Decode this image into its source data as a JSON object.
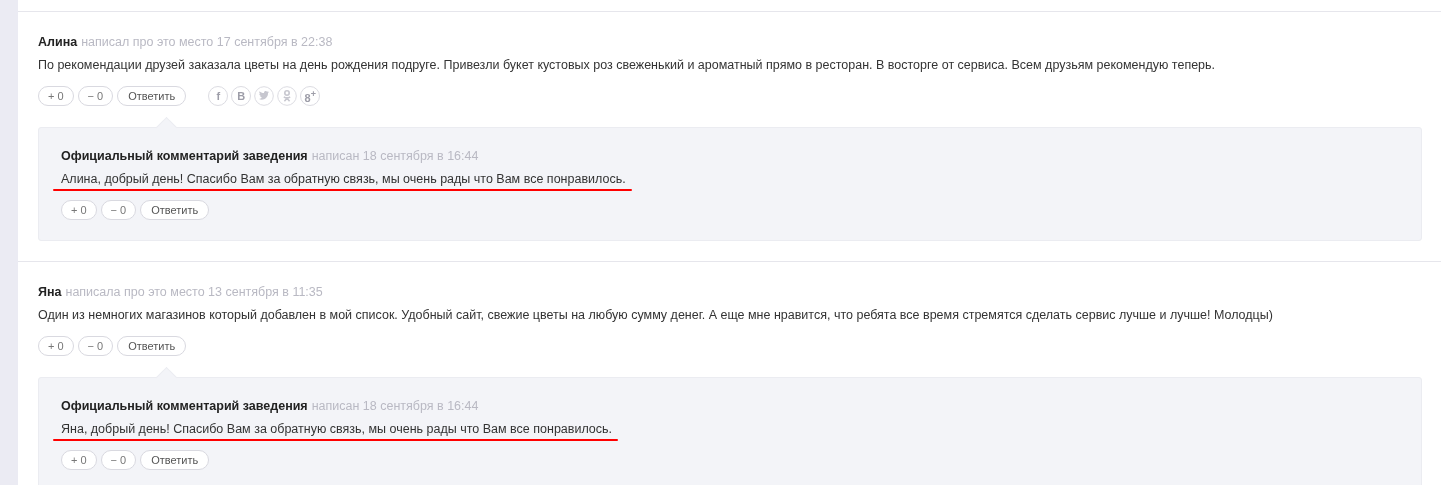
{
  "reviews": [
    {
      "author": "Алина",
      "meta": "написал про это место 17 сентября в 22:38",
      "text": "По рекомендации друзей заказала цветы на день рождения подруге. Привезли букет кустовых роз свеженький и ароматный прямо в ресторан. В восторге от сервиса. Всем друзьям рекомендую теперь.",
      "plus": "+ 0",
      "minus": "− 0",
      "reply_button": "Ответить",
      "share": [
        {
          "kind": "letter",
          "label": "f"
        },
        {
          "kind": "letter",
          "label": "B"
        },
        {
          "kind": "bird"
        },
        {
          "kind": "ok"
        },
        {
          "kind": "letter",
          "label": "8$^{+}$"
        }
      ],
      "official": {
        "author": "Официальный комментарий заведения",
        "meta": "написан 18 сентября в 16:44",
        "text": "Алина, добрый день! Спасибо Вам за обратную связь, мы очень рады что Вам все понравилось.",
        "underlined": true,
        "plus": "+ 0",
        "minus": "− 0",
        "reply_button": "Ответить"
      }
    },
    {
      "author": "Яна",
      "meta": "написала про это место 13 сентября в 11:35",
      "text": "Один из немногих магазинов который добавлен в мой список. Удобный сайт, свежие цветы на любую сумму денег. А еще мне нравится, что ребята все время стремятся сделать сервис лучше и лучше! Молодцы)",
      "plus": "+ 0",
      "minus": "− 0",
      "reply_button": "Ответить",
      "official": {
        "author": "Официальный комментарий заведения",
        "meta": "написан 18 сентября в 16:44",
        "text": "Яна, добрый день! Спасибо Вам за обратную связь, мы очень рады что Вам все понравилось.",
        "underlined": true,
        "plus": "+ 0",
        "minus": "− 0",
        "reply_button": "Ответить"
      }
    }
  ]
}
